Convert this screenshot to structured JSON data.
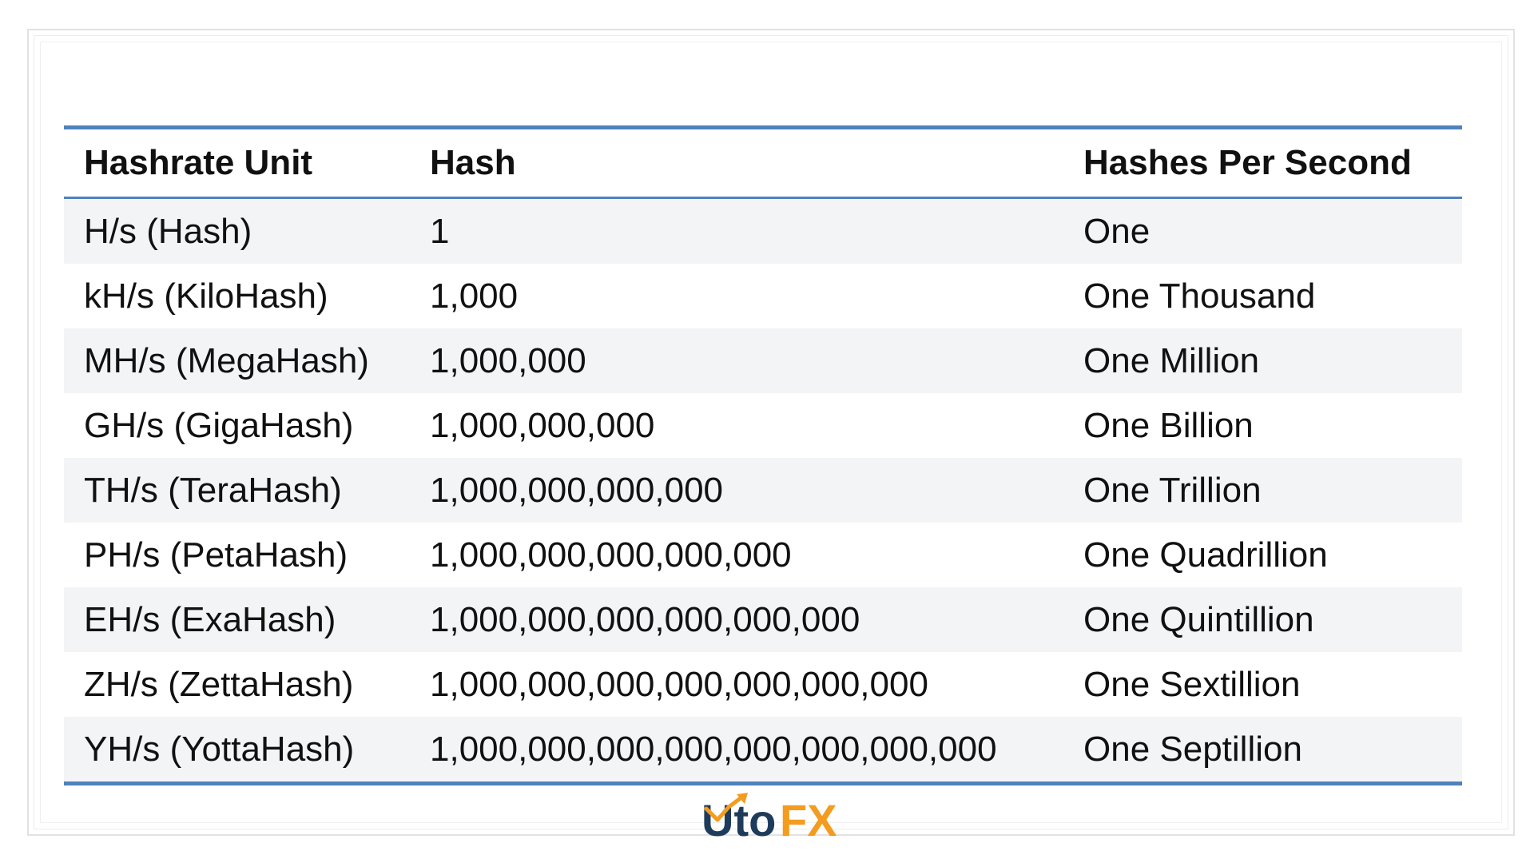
{
  "table": {
    "headers": [
      "Hashrate Unit",
      "Hash",
      "Hashes Per Second"
    ],
    "rows": [
      [
        "H/s (Hash)",
        "1",
        "One"
      ],
      [
        "kH/s (KiloHash)",
        "1,000",
        "One Thousand"
      ],
      [
        "MH/s (MegaHash)",
        "1,000,000",
        "One Million"
      ],
      [
        "GH/s (GigaHash)",
        "1,000,000,000",
        "One Billion"
      ],
      [
        "TH/s (TeraHash)",
        "1,000,000,000,000",
        "One Trillion"
      ],
      [
        "PH/s (PetaHash)",
        "1,000,000,000,000,000",
        "One Quadrillion"
      ],
      [
        "EH/s (ExaHash)",
        "1,000,000,000,000,000,000",
        "One Quintillion"
      ],
      [
        "ZH/s (ZettaHash)",
        "1,000,000,000,000,000,000,000",
        "One Sextillion"
      ],
      [
        "YH/s (YottaHash)",
        "1,000,000,000,000,000,000,000,000",
        "One Septillion"
      ]
    ]
  },
  "colors": {
    "rule": "#4f81bd",
    "shaded_row": "#f3f4f6",
    "logo_dark": "#1f3b5c",
    "logo_orange": "#f39c1f"
  },
  "logo": {
    "text_dark": "Uto",
    "text_accent": "FX",
    "icon": "growth-arrow-icon"
  }
}
